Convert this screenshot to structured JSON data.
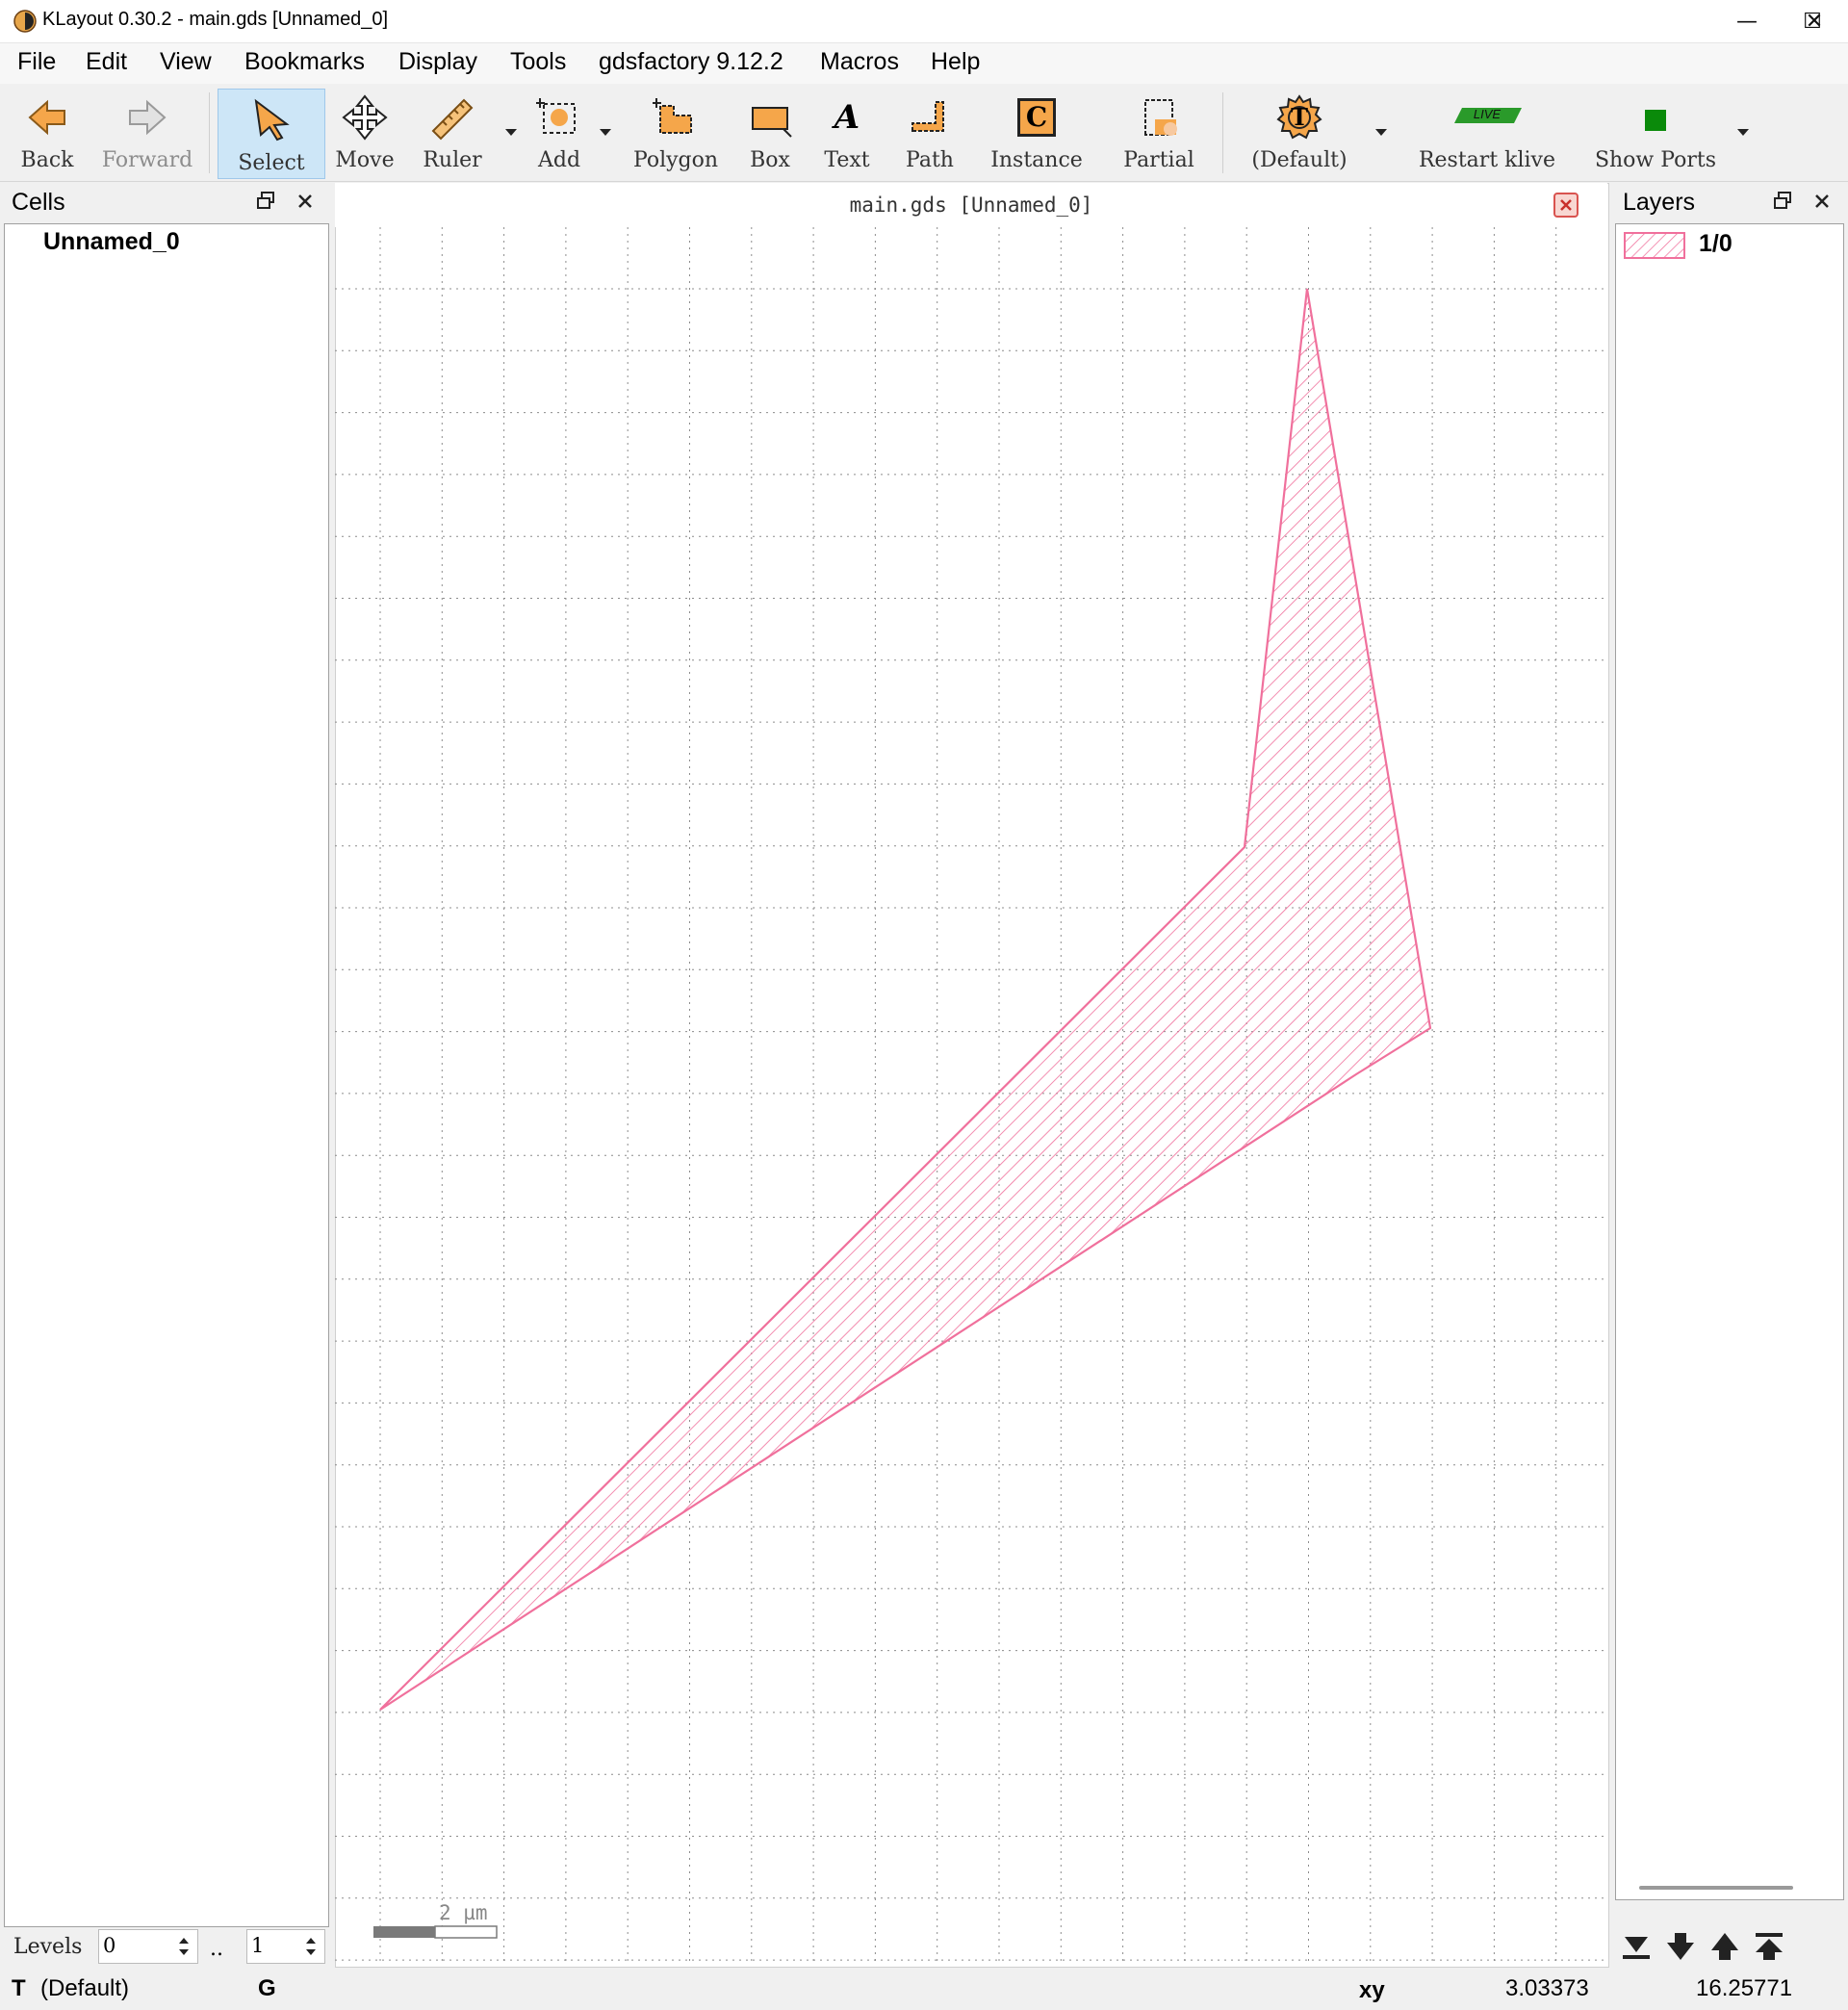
{
  "window": {
    "title": "KLayout 0.30.2 - main.gds [Unnamed_0]",
    "minimize": "—",
    "maximize": "☐",
    "close": "✕"
  },
  "menu": [
    "File",
    "Edit",
    "View",
    "Bookmarks",
    "Display",
    "Tools",
    "gdsfactory 9.12.2",
    "Macros",
    "Help"
  ],
  "toolbar": {
    "back": "Back",
    "forward": "Forward",
    "select": "Select",
    "move": "Move",
    "ruler": "Ruler",
    "add": "Add",
    "polygon": "Polygon",
    "box": "Box",
    "text": "Text",
    "path": "Path",
    "instance": "Instance",
    "partial": "Partial",
    "default": "(Default)",
    "restart_klive": "Restart klive",
    "live_badge": "LIVE",
    "show_ports": "Show Ports",
    "text_icon_glyph": "A",
    "instance_icon_glyph": "C",
    "default_icon_glyph": "T"
  },
  "cells_panel": {
    "title": "Cells",
    "items": [
      "Unnamed_0"
    ],
    "levels_label": "Levels",
    "level_from": "0",
    "level_sep": "..",
    "level_to": "1"
  },
  "canvas": {
    "tab_title": "main.gds [Unnamed_0]",
    "scale_label": "2 µm",
    "layer_color": "#f0709c"
  },
  "layers_panel": {
    "title": "Layers",
    "items": [
      {
        "name": "1/0",
        "color": "#f0709c"
      }
    ]
  },
  "status": {
    "mode_icon": "T",
    "mode": "(Default)",
    "grid_flag": "G",
    "coord_label": "xy",
    "x": "3.03373",
    "y": "16.25771"
  }
}
